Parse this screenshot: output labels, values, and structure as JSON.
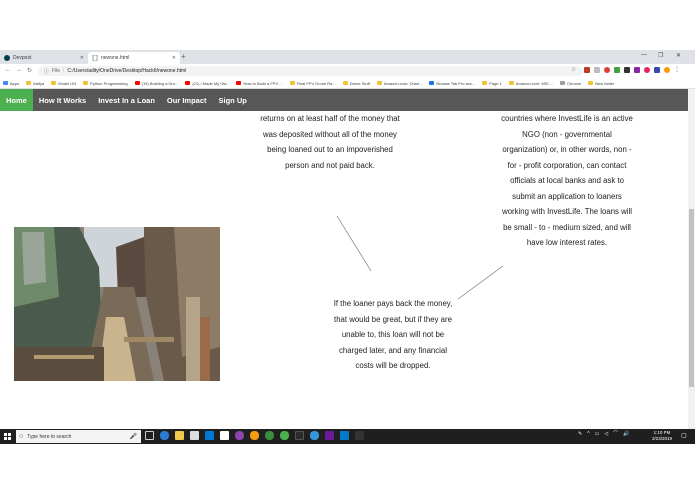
{
  "browser": {
    "tabs": [
      {
        "label": "Devpost",
        "active": false
      },
      {
        "label": "newone.html",
        "active": true
      }
    ],
    "address": {
      "scheme_label": "File",
      "url": "C:/Users/adity/OneDrive/Desktop/HackIt/newone.html"
    },
    "bookmarks": [
      {
        "label": "Apps",
        "color": "#4285f4"
      },
      {
        "label": "Aditya",
        "color": "#f4c430"
      },
      {
        "label": "Model UN",
        "color": "#f4c430"
      },
      {
        "label": "Python Programming",
        "color": "#f4c430"
      },
      {
        "label": "(19) Building a Dro...",
        "color": "#ff0000"
      },
      {
        "label": "(21) I Made My Ow...",
        "color": "#ff0000"
      },
      {
        "label": "How to Build a FPV ...",
        "color": "#ff0000"
      },
      {
        "label": "Final FPV Drone Ra...",
        "color": "#f4c430"
      },
      {
        "label": "Drone Stuff",
        "color": "#f4c430"
      },
      {
        "label": "Amazon.com: Charl...",
        "color": "#f4c430"
      },
      {
        "label": "Browse Tab Pro acc...",
        "color": "#1a73e8"
      },
      {
        "label": "Page 1",
        "color": "#f4c430"
      },
      {
        "label": "Amazon.com: MSI ...",
        "color": "#f4c430"
      },
      {
        "label": "Chrome",
        "color": "#9e9e9e"
      },
      {
        "label": "New folder",
        "color": "#f4c430"
      }
    ]
  },
  "site": {
    "nav": [
      {
        "label": "Home",
        "active": true
      },
      {
        "label": "How It Works",
        "active": false
      },
      {
        "label": "Invest In a Loan",
        "active": false
      },
      {
        "label": "Our Impact",
        "active": false
      },
      {
        "label": "Sign Up",
        "active": false
      }
    ],
    "accent": "#4caf50",
    "nav_bg": "#575757",
    "paragraphs": {
      "left": "returns on at least half of the money that was deposited without all of the money being loaned out to an impoverished person and not paid back.",
      "right": "countries where InvestLife is an active NGO (non - governmental organization) or, in other words, non - for - profit corporation, can contact officials at local banks and ask to submit an application to loaners working with InvestLife. The loans will be small - to - medium sized, and will have low interest rates.",
      "bottom": "If the loaner pays back the money, that would be great, but if they are unable to, this loan will not be charged later, and any financial costs will be dropped."
    }
  },
  "taskbar": {
    "search_placeholder": "Type here to search",
    "time": "1:10 PM",
    "date": "2/23/2019"
  }
}
